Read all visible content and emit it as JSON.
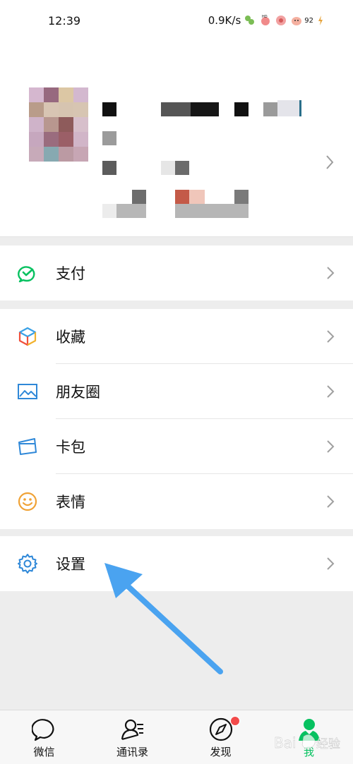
{
  "status_bar": {
    "time": "12:39",
    "net_speed": "0.9K/s",
    "battery": "92",
    "icons": [
      "notification-icon",
      "notification-icon",
      "notification-icon",
      "battery-icon",
      "charging-icon"
    ]
  },
  "profile": {
    "chevron_icon": "chevron-right-icon"
  },
  "menu": {
    "pay": {
      "label": "支付",
      "icon": "pay-icon",
      "color": "#07c160"
    },
    "favorites": {
      "label": "收藏",
      "icon": "cube-icon"
    },
    "moments": {
      "label": "朋友圈",
      "icon": "picture-icon",
      "color": "#2f88d8"
    },
    "cards": {
      "label": "卡包",
      "icon": "wallet-icon",
      "color": "#2f88d8"
    },
    "stickers": {
      "label": "表情",
      "icon": "smiley-icon",
      "color": "#f0a236"
    },
    "settings": {
      "label": "设置",
      "icon": "gear-icon",
      "color": "#2f88d8"
    }
  },
  "tabs": [
    {
      "label": "微信",
      "icon": "chat-bubble-icon"
    },
    {
      "label": "通讯录",
      "icon": "contacts-icon"
    },
    {
      "label": "发现",
      "icon": "compass-icon",
      "badge": true
    },
    {
      "label": "我",
      "icon": "person-icon",
      "active": true
    }
  ],
  "colors": {
    "accent": "#07c160",
    "badge": "#f24a4a",
    "arrow": "#4aa3f0",
    "background": "#ededed"
  },
  "watermark": "Bai 经验"
}
